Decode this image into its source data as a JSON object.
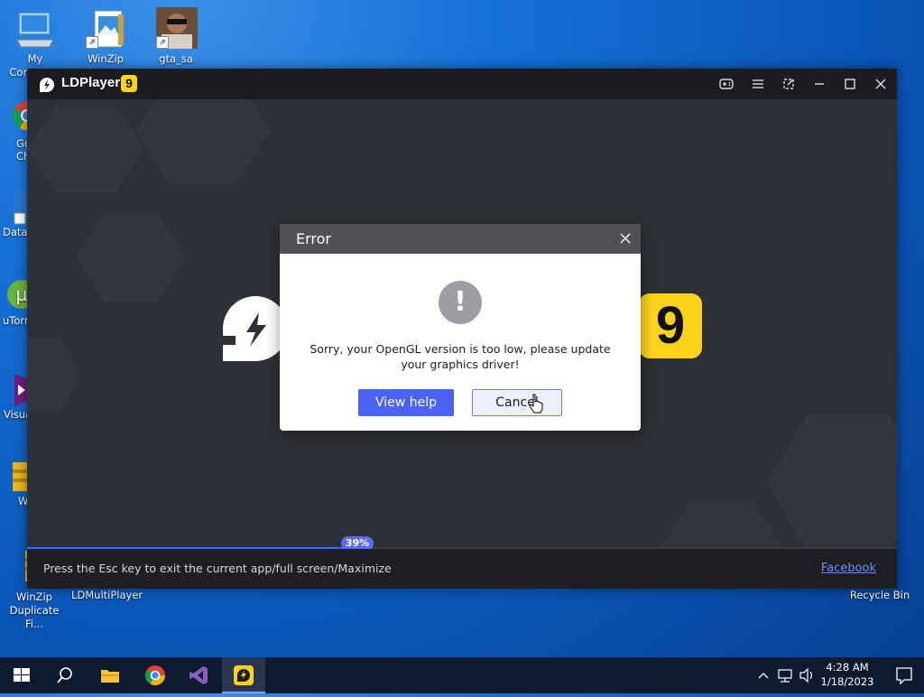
{
  "desktop": {
    "icons": [
      {
        "label": "My Computer",
        "icon": "computer-icon"
      },
      {
        "label": "WinZip Image",
        "icon": "winzip-image-icon"
      },
      {
        "label": "gta_sa",
        "icon": "gta-sa-icon"
      },
      {
        "label": "WinZip Duplicate Fi...",
        "icon": "winzip-icon"
      },
      {
        "label": "LDMultiPlayer",
        "icon": "ldmultiplayer-icon"
      },
      {
        "label": "Recycle Bin",
        "icon": "recycle-bin-icon"
      }
    ],
    "partial_icons": [
      {
        "label": "Go Ch",
        "icon": "chrome-icon"
      },
      {
        "label": "DataV",
        "icon": "datav-icon"
      },
      {
        "label": "uTorr",
        "icon": "utorrent-icon"
      },
      {
        "label": "Visua",
        "icon": "visual-studio-icon"
      },
      {
        "label": "W",
        "icon": "winzip-folder-icon"
      }
    ]
  },
  "ldplayer": {
    "title": "LDPlayer",
    "badge": "9",
    "big_badge": "9",
    "progress_label": "39%",
    "progress_value": 39,
    "esc_hint": "Press the Esc key to exit the current app/full screen/Maximize",
    "facebook": "Facebook",
    "titlebar_icons": [
      "gamepad-icon",
      "menu-icon",
      "resize-icon",
      "minimize-icon",
      "maximize-icon",
      "close-icon"
    ]
  },
  "dialog": {
    "title": "Error",
    "icon": "!",
    "message": "Sorry, your OpenGL version is too low, please update your graphics driver!",
    "view_help": "View help",
    "cancel": "Cancel"
  },
  "taskbar": {
    "time": "4:28 AM",
    "date": "1/18/2023",
    "apps": [
      "start-icon",
      "search-icon",
      "file-explorer-icon",
      "chrome-icon",
      "visual-studio-icon",
      "ldplayer-icon"
    ]
  },
  "colors": {
    "accent": "#4a63f0",
    "ld_yellow": "#ffd21c",
    "desktop_blue": "#0a56b8"
  }
}
